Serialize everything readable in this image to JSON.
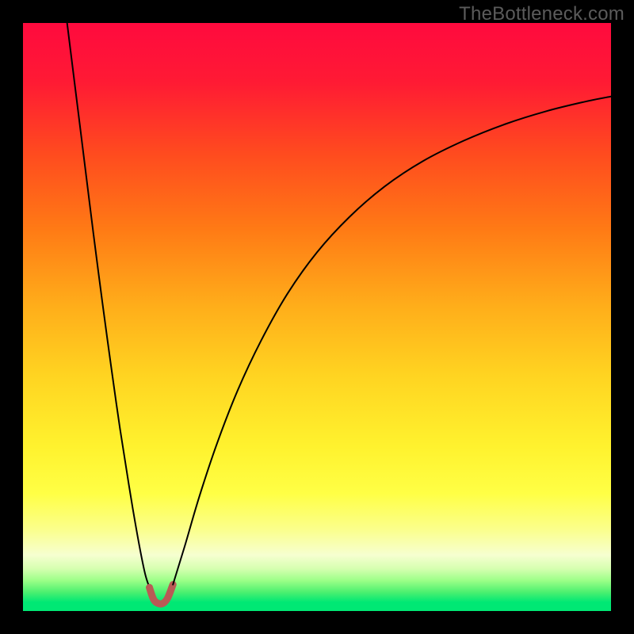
{
  "watermark": "TheBottleneck.com",
  "chart_data": {
    "type": "line",
    "title": "",
    "xlabel": "",
    "ylabel": "",
    "xlim": [
      0,
      100
    ],
    "ylim": [
      0,
      100
    ],
    "grid": false,
    "legend": false,
    "gradient_stops": [
      {
        "pos": 0.0,
        "color": "#ff0a3e"
      },
      {
        "pos": 0.1,
        "color": "#ff1a34"
      },
      {
        "pos": 0.22,
        "color": "#ff4a1f"
      },
      {
        "pos": 0.35,
        "color": "#ff7a15"
      },
      {
        "pos": 0.48,
        "color": "#ffad1a"
      },
      {
        "pos": 0.6,
        "color": "#ffd421"
      },
      {
        "pos": 0.72,
        "color": "#fff22e"
      },
      {
        "pos": 0.8,
        "color": "#ffff45"
      },
      {
        "pos": 0.86,
        "color": "#fbff8a"
      },
      {
        "pos": 0.905,
        "color": "#f6ffd0"
      },
      {
        "pos": 0.928,
        "color": "#d6ffb0"
      },
      {
        "pos": 0.948,
        "color": "#9cff88"
      },
      {
        "pos": 0.968,
        "color": "#4cf070"
      },
      {
        "pos": 0.985,
        "color": "#00e874"
      },
      {
        "pos": 1.0,
        "color": "#00e874"
      }
    ],
    "series": [
      {
        "name": "left-branch",
        "stroke": "#000000",
        "width": 2.0,
        "points": [
          {
            "x": 7.5,
            "y": 100.0
          },
          {
            "x": 9.0,
            "y": 88.0
          },
          {
            "x": 10.5,
            "y": 76.0
          },
          {
            "x": 12.0,
            "y": 64.0
          },
          {
            "x": 13.5,
            "y": 52.5
          },
          {
            "x": 15.0,
            "y": 41.5
          },
          {
            "x": 16.5,
            "y": 31.0
          },
          {
            "x": 18.0,
            "y": 21.5
          },
          {
            "x": 19.0,
            "y": 15.5
          },
          {
            "x": 20.0,
            "y": 10.0
          },
          {
            "x": 20.8,
            "y": 6.2
          },
          {
            "x": 21.5,
            "y": 4.0
          }
        ]
      },
      {
        "name": "bottom-dip",
        "stroke": "#b95a55",
        "width": 9.0,
        "points": [
          {
            "x": 21.5,
            "y": 4.0
          },
          {
            "x": 22.2,
            "y": 2.0
          },
          {
            "x": 23.0,
            "y": 1.3
          },
          {
            "x": 23.8,
            "y": 1.3
          },
          {
            "x": 24.6,
            "y": 2.2
          },
          {
            "x": 25.5,
            "y": 4.5
          }
        ]
      },
      {
        "name": "right-branch",
        "stroke": "#000000",
        "width": 2.0,
        "points": [
          {
            "x": 25.5,
            "y": 4.5
          },
          {
            "x": 27.5,
            "y": 11.0
          },
          {
            "x": 30.0,
            "y": 19.5
          },
          {
            "x": 33.0,
            "y": 28.5
          },
          {
            "x": 36.5,
            "y": 37.5
          },
          {
            "x": 40.5,
            "y": 46.0
          },
          {
            "x": 45.0,
            "y": 54.0
          },
          {
            "x": 50.0,
            "y": 61.0
          },
          {
            "x": 55.5,
            "y": 67.0
          },
          {
            "x": 61.5,
            "y": 72.2
          },
          {
            "x": 68.0,
            "y": 76.5
          },
          {
            "x": 75.0,
            "y": 80.0
          },
          {
            "x": 82.0,
            "y": 82.8
          },
          {
            "x": 89.0,
            "y": 85.0
          },
          {
            "x": 95.5,
            "y": 86.6
          },
          {
            "x": 100.0,
            "y": 87.5
          }
        ]
      }
    ]
  }
}
